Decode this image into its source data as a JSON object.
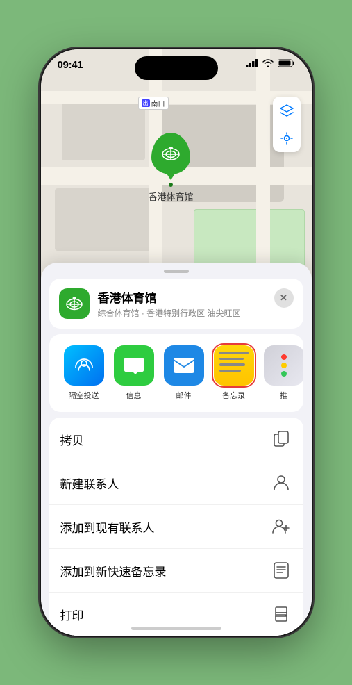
{
  "status": {
    "time": "09:41",
    "signal": "●●●",
    "wifi": "wifi",
    "battery": "battery"
  },
  "map": {
    "south_label": "南口",
    "stadium_name": "香港体育馆"
  },
  "venue": {
    "name": "香港体育馆",
    "subtitle": "综合体育馆 · 香港特别行政区 油尖旺区",
    "close_label": "✕"
  },
  "share_items": [
    {
      "id": "airdrop",
      "label": "隔空投送",
      "type": "airdrop"
    },
    {
      "id": "message",
      "label": "信息",
      "type": "message"
    },
    {
      "id": "mail",
      "label": "邮件",
      "type": "mail"
    },
    {
      "id": "notes",
      "label": "备忘录",
      "type": "notes"
    },
    {
      "id": "more",
      "label": "推",
      "type": "more"
    }
  ],
  "actions": [
    {
      "id": "copy",
      "label": "拷贝",
      "icon": "copy"
    },
    {
      "id": "new-contact",
      "label": "新建联系人",
      "icon": "person"
    },
    {
      "id": "add-existing",
      "label": "添加到现有联系人",
      "icon": "person-add"
    },
    {
      "id": "add-notes",
      "label": "添加到新快速备忘录",
      "icon": "note"
    },
    {
      "id": "print",
      "label": "打印",
      "icon": "printer"
    }
  ]
}
